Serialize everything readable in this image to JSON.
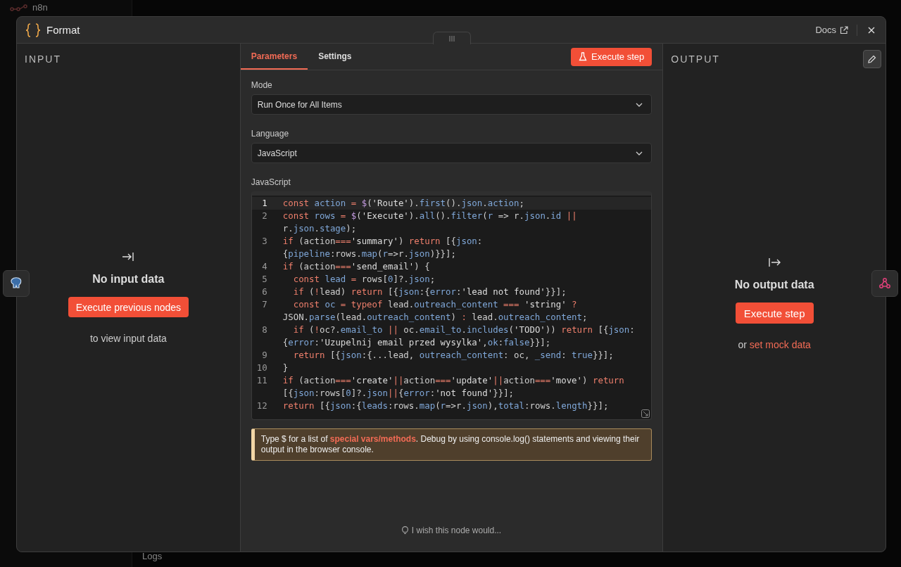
{
  "background": {
    "logo_text": "n8n",
    "logs_label": "Logs"
  },
  "window": {
    "title": "Format",
    "docs_link": "Docs"
  },
  "input": {
    "heading": "INPUT",
    "empty_title": "No input data",
    "button": "Execute previous nodes",
    "hint": "to view input data"
  },
  "tabs": [
    {
      "label": "Parameters",
      "selected": true
    },
    {
      "label": "Settings",
      "selected": false
    }
  ],
  "execute_button": "Execute step",
  "fields": [
    {
      "label": "Mode",
      "value": "Run Once for All Items"
    },
    {
      "label": "Language",
      "value": "JavaScript"
    }
  ],
  "editor": {
    "label": "JavaScript",
    "lines": [
      {
        "number": "1",
        "active": true,
        "rows": [
          {
            "tokens": [
              {
                "text": "const ",
                "kind": "keyword"
              },
              {
                "text": "action",
                "kind": "name"
              },
              {
                "text": " = ",
                "kind": "keyword"
              },
              {
                "text": "$",
                "kind": "special"
              },
              {
                "text": "(",
                "kind": "plain"
              },
              {
                "text": "'Route'",
                "kind": "string"
              },
              {
                "text": ").",
                "kind": "plain"
              },
              {
                "text": "first",
                "kind": "name"
              },
              {
                "text": "().",
                "kind": "plain"
              },
              {
                "text": "json",
                "kind": "name"
              },
              {
                "text": ".",
                "kind": "plain"
              },
              {
                "text": "action",
                "kind": "name"
              },
              {
                "text": ";",
                "kind": "plain"
              }
            ]
          }
        ]
      },
      {
        "number": "2",
        "active": false,
        "rows": [
          {
            "tokens": [
              {
                "text": "const ",
                "kind": "keyword"
              },
              {
                "text": "rows",
                "kind": "name"
              },
              {
                "text": " = ",
                "kind": "keyword"
              },
              {
                "text": "$",
                "kind": "special"
              },
              {
                "text": "(",
                "kind": "plain"
              },
              {
                "text": "'Execute'",
                "kind": "string"
              },
              {
                "text": ").",
                "kind": "plain"
              },
              {
                "text": "all",
                "kind": "name"
              },
              {
                "text": "().",
                "kind": "plain"
              },
              {
                "text": "filter",
                "kind": "name"
              },
              {
                "text": "(",
                "kind": "plain"
              },
              {
                "text": "r",
                "kind": "name"
              },
              {
                "text": " => r.",
                "kind": "plain"
              },
              {
                "text": "json",
                "kind": "name"
              },
              {
                "text": ".",
                "kind": "plain"
              },
              {
                "text": "id",
                "kind": "name"
              },
              {
                "text": " ||",
                "kind": "keyword"
              }
            ]
          },
          {
            "tokens": [
              {
                "text": "r.",
                "kind": "plain"
              },
              {
                "text": "json",
                "kind": "name"
              },
              {
                "text": ".",
                "kind": "plain"
              },
              {
                "text": "stage",
                "kind": "name"
              },
              {
                "text": ");",
                "kind": "plain"
              }
            ]
          }
        ]
      },
      {
        "number": "3",
        "active": false,
        "rows": [
          {
            "tokens": [
              {
                "text": "if",
                "kind": "keyword"
              },
              {
                "text": " (action",
                "kind": "plain"
              },
              {
                "text": "===",
                "kind": "keyword"
              },
              {
                "text": "'summary'",
                "kind": "string"
              },
              {
                "text": ") ",
                "kind": "plain"
              },
              {
                "text": "return",
                "kind": "keyword"
              },
              {
                "text": " [{",
                "kind": "plain"
              },
              {
                "text": "json",
                "kind": "name"
              },
              {
                "text": ":",
                "kind": "plain"
              }
            ]
          },
          {
            "tokens": [
              {
                "text": "{",
                "kind": "plain"
              },
              {
                "text": "pipeline",
                "kind": "name"
              },
              {
                "text": ":rows.",
                "kind": "plain"
              },
              {
                "text": "map",
                "kind": "name"
              },
              {
                "text": "(",
                "kind": "plain"
              },
              {
                "text": "r",
                "kind": "name"
              },
              {
                "text": "=>r.",
                "kind": "plain"
              },
              {
                "text": "json",
                "kind": "name"
              },
              {
                "text": ")}}];",
                "kind": "plain"
              }
            ]
          }
        ]
      },
      {
        "number": "4",
        "active": false,
        "rows": [
          {
            "tokens": [
              {
                "text": "if",
                "kind": "keyword"
              },
              {
                "text": " (action",
                "kind": "plain"
              },
              {
                "text": "===",
                "kind": "keyword"
              },
              {
                "text": "'send_email'",
                "kind": "string"
              },
              {
                "text": ") {",
                "kind": "plain"
              }
            ]
          }
        ]
      },
      {
        "number": "5",
        "active": false,
        "rows": [
          {
            "tokens": [
              {
                "text": "  const ",
                "kind": "keyword"
              },
              {
                "text": "lead",
                "kind": "name"
              },
              {
                "text": " =",
                "kind": "keyword"
              },
              {
                "text": " rows[",
                "kind": "plain"
              },
              {
                "text": "0",
                "kind": "name"
              },
              {
                "text": "]?.",
                "kind": "plain"
              },
              {
                "text": "json",
                "kind": "name"
              },
              {
                "text": ";",
                "kind": "plain"
              }
            ]
          }
        ]
      },
      {
        "number": "6",
        "active": false,
        "rows": [
          {
            "tokens": [
              {
                "text": "  if",
                "kind": "keyword"
              },
              {
                "text": " (",
                "kind": "plain"
              },
              {
                "text": "!",
                "kind": "keyword"
              },
              {
                "text": "lead) ",
                "kind": "plain"
              },
              {
                "text": "return",
                "kind": "keyword"
              },
              {
                "text": " [{",
                "kind": "plain"
              },
              {
                "text": "json",
                "kind": "name"
              },
              {
                "text": ":{",
                "kind": "plain"
              },
              {
                "text": "error",
                "kind": "name"
              },
              {
                "text": ":",
                "kind": "plain"
              },
              {
                "text": "'lead not found'",
                "kind": "string"
              },
              {
                "text": "}}];",
                "kind": "plain"
              }
            ]
          }
        ]
      },
      {
        "number": "7",
        "active": false,
        "rows": [
          {
            "tokens": [
              {
                "text": "  const ",
                "kind": "keyword"
              },
              {
                "text": "oc",
                "kind": "name"
              },
              {
                "text": " = typeof",
                "kind": "keyword"
              },
              {
                "text": " lead.",
                "kind": "plain"
              },
              {
                "text": "outreach_content",
                "kind": "name"
              },
              {
                "text": " === ",
                "kind": "keyword"
              },
              {
                "text": "'string'",
                "kind": "string"
              },
              {
                "text": " ?",
                "kind": "keyword"
              }
            ]
          },
          {
            "tokens": [
              {
                "text": "JSON.",
                "kind": "plain"
              },
              {
                "text": "parse",
                "kind": "name"
              },
              {
                "text": "(lead.",
                "kind": "plain"
              },
              {
                "text": "outreach_content",
                "kind": "name"
              },
              {
                "text": ") ",
                "kind": "plain"
              },
              {
                "text": ":",
                "kind": "keyword"
              },
              {
                "text": " lead.",
                "kind": "plain"
              },
              {
                "text": "outreach_content",
                "kind": "name"
              },
              {
                "text": ";",
                "kind": "plain"
              }
            ]
          }
        ]
      },
      {
        "number": "8",
        "active": false,
        "rows": [
          {
            "tokens": [
              {
                "text": "  if",
                "kind": "keyword"
              },
              {
                "text": " (",
                "kind": "plain"
              },
              {
                "text": "!",
                "kind": "keyword"
              },
              {
                "text": "oc?.",
                "kind": "plain"
              },
              {
                "text": "email_to",
                "kind": "name"
              },
              {
                "text": " || ",
                "kind": "keyword"
              },
              {
                "text": "oc.",
                "kind": "plain"
              },
              {
                "text": "email_to",
                "kind": "name"
              },
              {
                "text": ".",
                "kind": "plain"
              },
              {
                "text": "includes",
                "kind": "name"
              },
              {
                "text": "(",
                "kind": "plain"
              },
              {
                "text": "'TODO'",
                "kind": "string"
              },
              {
                "text": ")) ",
                "kind": "plain"
              },
              {
                "text": "return",
                "kind": "keyword"
              },
              {
                "text": " [{",
                "kind": "plain"
              },
              {
                "text": "json",
                "kind": "name"
              },
              {
                "text": ":",
                "kind": "plain"
              }
            ]
          },
          {
            "tokens": [
              {
                "text": "{",
                "kind": "plain"
              },
              {
                "text": "error",
                "kind": "name"
              },
              {
                "text": ":",
                "kind": "plain"
              },
              {
                "text": "'Uzupelnij email przed wysylka'",
                "kind": "string"
              },
              {
                "text": ",",
                "kind": "plain"
              },
              {
                "text": "ok",
                "kind": "name"
              },
              {
                "text": ":",
                "kind": "plain"
              },
              {
                "text": "false",
                "kind": "name"
              },
              {
                "text": "}}];",
                "kind": "plain"
              }
            ]
          }
        ]
      },
      {
        "number": "9",
        "active": false,
        "rows": [
          {
            "tokens": [
              {
                "text": "  return",
                "kind": "keyword"
              },
              {
                "text": " [{",
                "kind": "plain"
              },
              {
                "text": "json",
                "kind": "name"
              },
              {
                "text": ":{...lead, ",
                "kind": "plain"
              },
              {
                "text": "outreach_content",
                "kind": "name"
              },
              {
                "text": ": oc, ",
                "kind": "plain"
              },
              {
                "text": "_send",
                "kind": "name"
              },
              {
                "text": ": ",
                "kind": "plain"
              },
              {
                "text": "true",
                "kind": "name"
              },
              {
                "text": "}}];",
                "kind": "plain"
              }
            ]
          }
        ]
      },
      {
        "number": "10",
        "active": false,
        "rows": [
          {
            "tokens": [
              {
                "text": "}",
                "kind": "plain"
              }
            ]
          }
        ]
      },
      {
        "number": "11",
        "active": false,
        "rows": [
          {
            "tokens": [
              {
                "text": "if",
                "kind": "keyword"
              },
              {
                "text": " (action",
                "kind": "plain"
              },
              {
                "text": "===",
                "kind": "keyword"
              },
              {
                "text": "'create'",
                "kind": "string"
              },
              {
                "text": "||",
                "kind": "keyword"
              },
              {
                "text": "action",
                "kind": "plain"
              },
              {
                "text": "===",
                "kind": "keyword"
              },
              {
                "text": "'update'",
                "kind": "string"
              },
              {
                "text": "||",
                "kind": "keyword"
              },
              {
                "text": "action",
                "kind": "plain"
              },
              {
                "text": "===",
                "kind": "keyword"
              },
              {
                "text": "'move'",
                "kind": "string"
              },
              {
                "text": ") ",
                "kind": "plain"
              },
              {
                "text": "return",
                "kind": "keyword"
              }
            ]
          },
          {
            "tokens": [
              {
                "text": "[{",
                "kind": "plain"
              },
              {
                "text": "json",
                "kind": "name"
              },
              {
                "text": ":rows[",
                "kind": "plain"
              },
              {
                "text": "0",
                "kind": "name"
              },
              {
                "text": "]?.",
                "kind": "plain"
              },
              {
                "text": "json",
                "kind": "name"
              },
              {
                "text": "||",
                "kind": "keyword"
              },
              {
                "text": "{",
                "kind": "plain"
              },
              {
                "text": "error",
                "kind": "name"
              },
              {
                "text": ":",
                "kind": "plain"
              },
              {
                "text": "'not found'",
                "kind": "string"
              },
              {
                "text": "}}];",
                "kind": "plain"
              }
            ]
          }
        ]
      },
      {
        "number": "12",
        "active": false,
        "rows": [
          {
            "tokens": [
              {
                "text": "return",
                "kind": "keyword"
              },
              {
                "text": " [{",
                "kind": "plain"
              },
              {
                "text": "json",
                "kind": "name"
              },
              {
                "text": ":{",
                "kind": "plain"
              },
              {
                "text": "leads",
                "kind": "name"
              },
              {
                "text": ":rows.",
                "kind": "plain"
              },
              {
                "text": "map",
                "kind": "name"
              },
              {
                "text": "(",
                "kind": "plain"
              },
              {
                "text": "r",
                "kind": "name"
              },
              {
                "text": "=>r.",
                "kind": "plain"
              },
              {
                "text": "json",
                "kind": "name"
              },
              {
                "text": "),",
                "kind": "plain"
              },
              {
                "text": "total",
                "kind": "name"
              },
              {
                "text": ":rows.",
                "kind": "plain"
              },
              {
                "text": "length",
                "kind": "name"
              },
              {
                "text": "}}];",
                "kind": "plain"
              }
            ]
          }
        ]
      }
    ]
  },
  "notice": {
    "text_before": "Type $ for a list of ",
    "link": "special vars/methods",
    "text_after": ". Debug by using console.log() statements and viewing their output in the browser console."
  },
  "feedback": "I wish this node would...",
  "output": {
    "heading": "OUTPUT",
    "empty_title": "No output data",
    "button": "Execute step",
    "hint_before": "or ",
    "hint_link": "set mock data"
  }
}
